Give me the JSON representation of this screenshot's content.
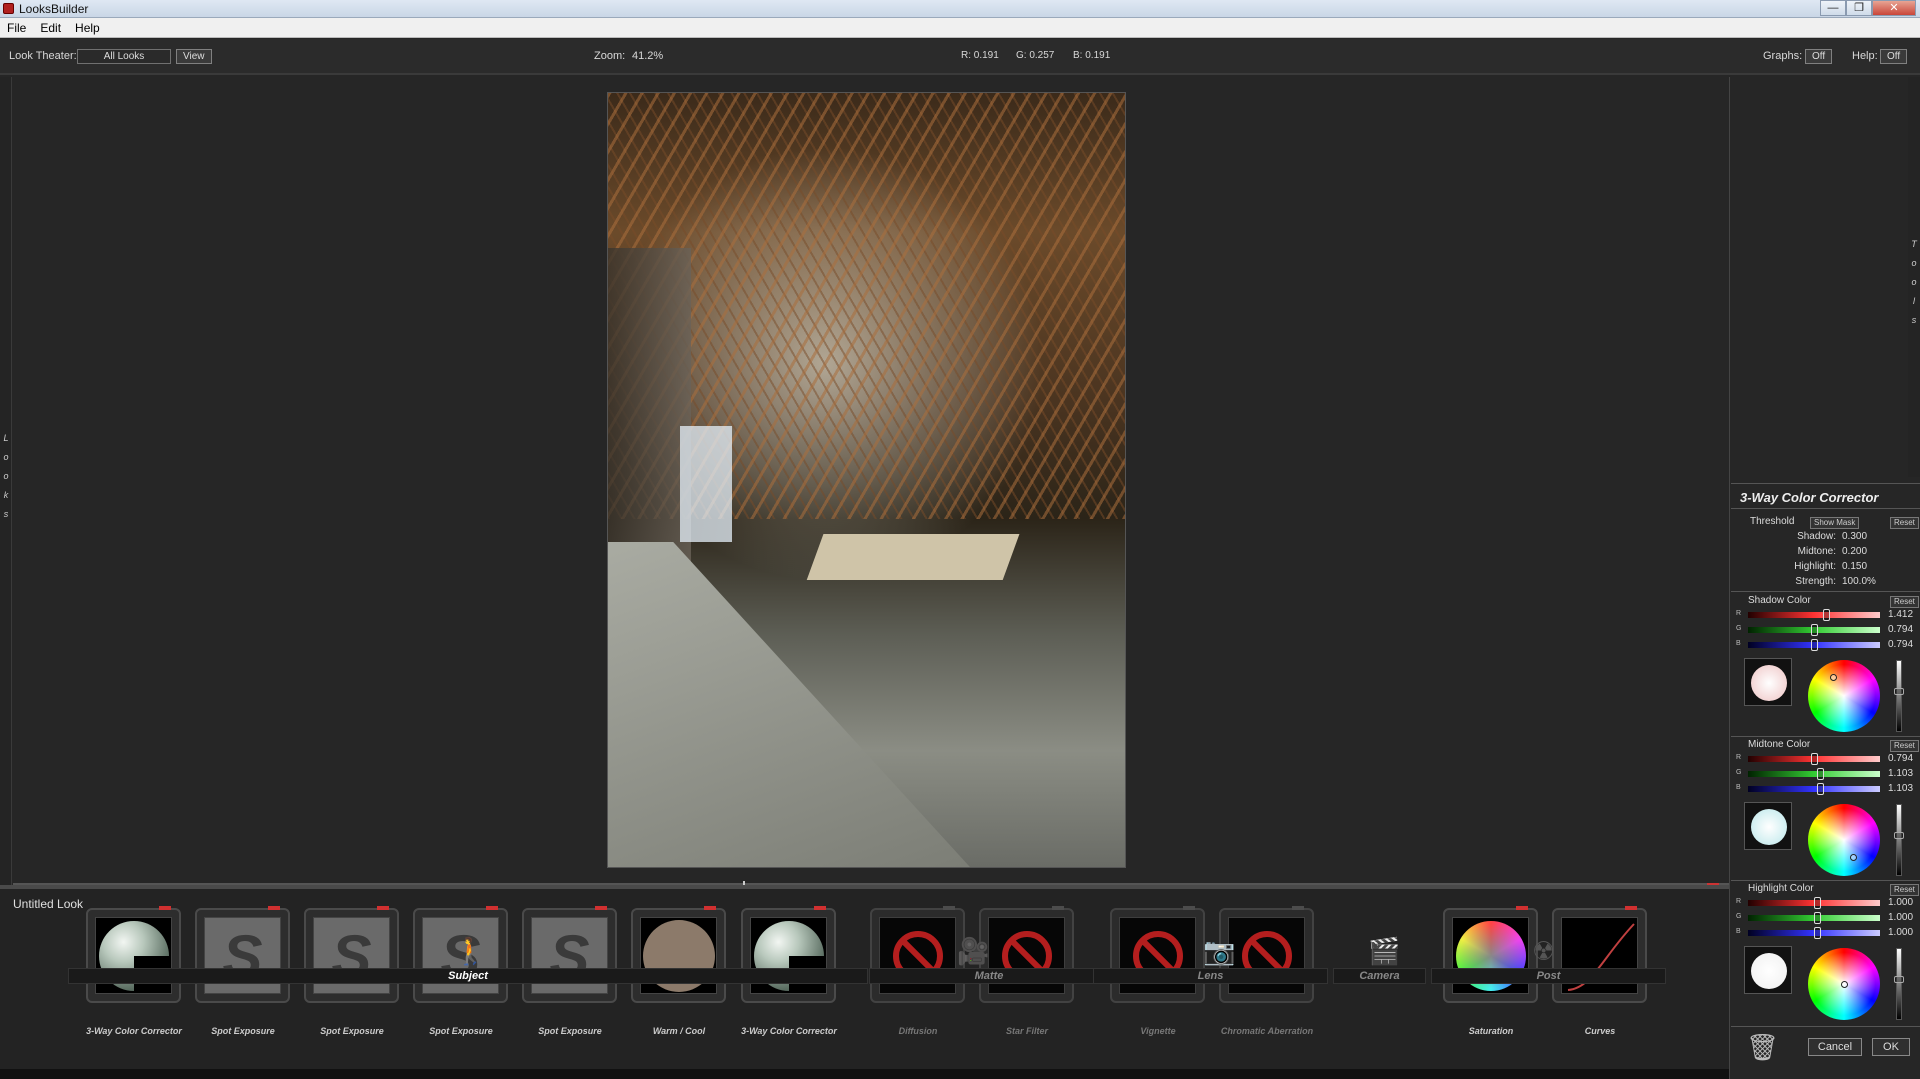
{
  "window": {
    "title": "LooksBuilder",
    "controls": [
      "—",
      "❐",
      "✕"
    ]
  },
  "menu": [
    "File",
    "Edit",
    "Help"
  ],
  "toolbar": {
    "look_theater_label": "Look Theater:",
    "look_theater_value": "All Looks",
    "view_button": "View",
    "zoom_label": "Zoom:",
    "zoom_value": "41.2%",
    "r_readout": "R: 0.191",
    "g_readout": "G: 0.257",
    "b_readout": "B: 0.191",
    "graphs_label": "Graphs:",
    "graphs_value": "Off",
    "help_label": "Help:",
    "help_value": "Off"
  },
  "side_tabs": {
    "looks": [
      "L",
      "o",
      "o",
      "k",
      "s"
    ],
    "tools": [
      "T",
      "o",
      "o",
      "l",
      "s"
    ]
  },
  "look": {
    "name": "Untitled Look",
    "tools": [
      {
        "label": "3-Way Color Corrector",
        "kind": "sphere",
        "active": true
      },
      {
        "label": "Spot Exposure",
        "kind": "spot",
        "active": true
      },
      {
        "label": "Spot Exposure",
        "kind": "spot",
        "active": true
      },
      {
        "label": "Spot Exposure",
        "kind": "spot",
        "active": true
      },
      {
        "label": "Spot Exposure",
        "kind": "spot",
        "active": true
      },
      {
        "label": "Warm / Cool",
        "kind": "warm",
        "active": true
      },
      {
        "label": "3-Way Color Corrector",
        "kind": "sphere",
        "active": true
      },
      {
        "label": "Diffusion",
        "kind": "nosign",
        "active": false
      },
      {
        "label": "Star Filter",
        "kind": "nosign",
        "active": false
      },
      {
        "label": "Vignette",
        "kind": "nosign",
        "active": false
      },
      {
        "label": "Chromatic Aberration",
        "kind": "nosign",
        "active": false
      },
      {
        "label": "Saturation",
        "kind": "satwheel",
        "active": true
      },
      {
        "label": "Curves",
        "kind": "curve",
        "active": true
      }
    ]
  },
  "categories": [
    {
      "label": "Subject",
      "icon": "walking-person-icon",
      "active": true
    },
    {
      "label": "Matte",
      "icon": "matte-camera-icon",
      "active": false
    },
    {
      "label": "Lens",
      "icon": "lens-camera-icon",
      "active": false
    },
    {
      "label": "Camera",
      "icon": "movie-camera-icon",
      "active": false
    },
    {
      "label": "Post",
      "icon": "radiation-icon",
      "active": false
    }
  ],
  "panel": {
    "title": "3-Way Color Corrector",
    "threshold": {
      "label": "Threshold",
      "show_mask": "Show Mask",
      "reset": "Reset",
      "shadow": "Shadow:",
      "shadow_val": "0.300",
      "midtone": "Midtone:",
      "midtone_val": "0.200",
      "highlight": "Highlight:",
      "highlight_val": "0.150",
      "strength": "Strength:",
      "strength_val": "100.0%"
    },
    "shadow_color": {
      "label": "Shadow Color",
      "reset": "Reset",
      "r": "1.412",
      "g": "0.794",
      "b": "0.794",
      "r_frac": 0.6,
      "g_frac": 0.5,
      "b_frac": 0.5,
      "swatch": "#f3d5d5"
    },
    "midtone_color": {
      "label": "Midtone Color",
      "reset": "Reset",
      "r": "0.794",
      "g": "1.103",
      "b": "1.103",
      "r_frac": 0.5,
      "g_frac": 0.55,
      "b_frac": 0.55,
      "swatch": "#cfeef0"
    },
    "highlight_color": {
      "label": "Highlight Color",
      "reset": "Reset",
      "r": "1.000",
      "g": "1.000",
      "b": "1.000",
      "r_frac": 0.53,
      "g_frac": 0.53,
      "b_frac": 0.53,
      "swatch": "#f4f4f4"
    },
    "channel_letters": [
      "R",
      "G",
      "B"
    ],
    "cancel": "Cancel",
    "ok": "OK"
  }
}
